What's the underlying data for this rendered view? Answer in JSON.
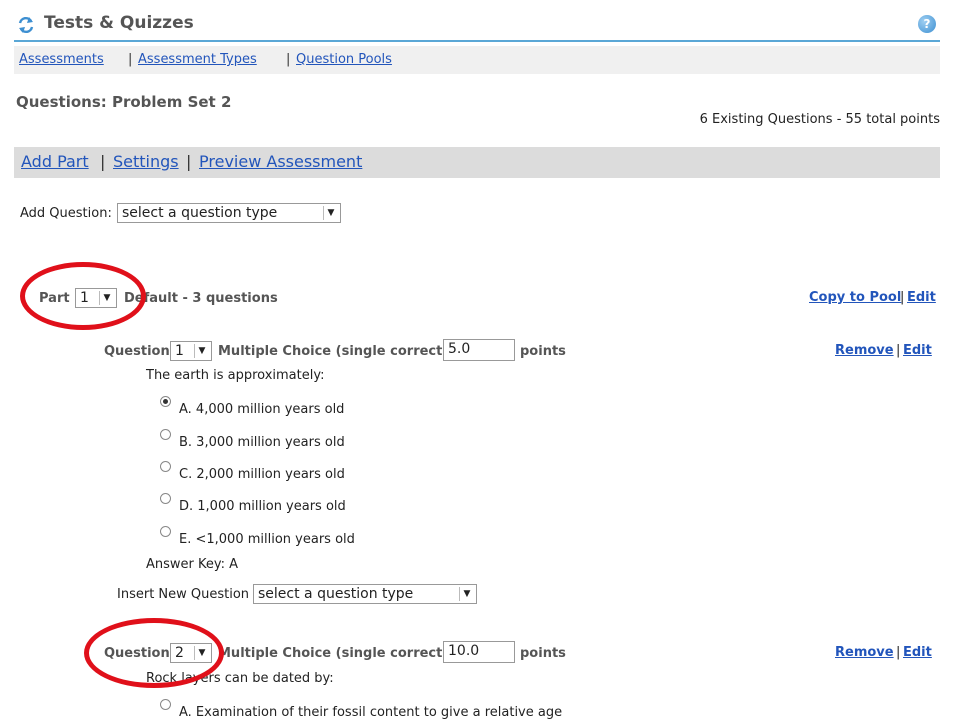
{
  "header": {
    "title": "Tests & Quizzes",
    "help_glyph": "?"
  },
  "nav": {
    "items": [
      "Assessments",
      "Assessment Types",
      "Question Pools"
    ],
    "sep": "|"
  },
  "page": {
    "title": "Questions: Problem Set 2",
    "summary": "6 Existing Questions - 55 total points"
  },
  "actions": {
    "items": [
      "Add Part",
      "Settings",
      "Preview Assessment"
    ],
    "sep": "|"
  },
  "add_question": {
    "label": "Add Question:",
    "select": "select a question type"
  },
  "part": {
    "label": "Part",
    "number": "1",
    "description": "Default - 3 questions",
    "copy_to_pool": "Copy to Pool",
    "edit": "Edit"
  },
  "questions": [
    {
      "label": "Question",
      "number": "1",
      "type": "Multiple Choice (single correct) -",
      "points": "5.0",
      "points_label": "points",
      "remove": "Remove",
      "edit": "Edit",
      "text": "The earth is approximately:",
      "choices": [
        "A. 4,000 million years old",
        "B. 3,000 million years old",
        "C. 2,000 million years old",
        "D. 1,000 million years old",
        "E. <1,000 million years old"
      ],
      "selected": 0,
      "answer_key": "Answer Key: A"
    },
    {
      "label": "Question",
      "number": "2",
      "type": "Multiple Choice (single correct) -",
      "points": "10.0",
      "points_label": "points",
      "remove": "Remove",
      "edit": "Edit",
      "text": "Rock layers can be dated by:",
      "choices": [
        "A. Examination of their fossil content to give a relative age"
      ]
    }
  ],
  "insert_question": {
    "label": "Insert New Question",
    "select": "select a question type"
  },
  "colors": {
    "link": "#2255bb",
    "accent_rule": "#5aa7d6",
    "annotation": "#e0101a"
  }
}
